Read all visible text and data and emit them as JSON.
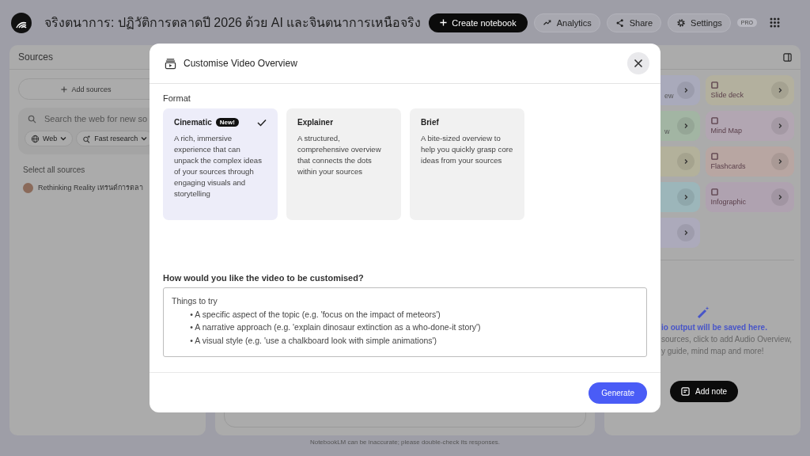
{
  "header": {
    "title": "จริงตนาการ: ปฏิวัติการตลาดปี 2026 ด้วย AI และจินตนาการเหนือจริง",
    "create_button": "Create notebook",
    "actions": [
      {
        "label": "Analytics",
        "kind": "analytics"
      },
      {
        "label": "Share",
        "kind": "share"
      },
      {
        "label": "Settings",
        "kind": "settings"
      }
    ],
    "badge": "PRO"
  },
  "sources": {
    "title": "Sources",
    "add_button": "Add sources",
    "search": {
      "placeholder": "Search the web for new so"
    },
    "chips": [
      {
        "label": "Web",
        "kind": "web"
      },
      {
        "label": "Fast research",
        "kind": "research"
      }
    ],
    "select_all": "Select all sources",
    "items": [
      {
        "label": "Rethinking Reality เทรนด์การตลา"
      }
    ]
  },
  "studio": {
    "tiles": [
      {
        "label": "ew",
        "color": "#a9aabb"
      },
      {
        "label": "Slide deck",
        "color": "#b3b09e"
      },
      {
        "label": "w",
        "color": "#a2b5a3"
      },
      {
        "label": "Mind Map",
        "color": "#b2a6b2"
      },
      {
        "color": "#b3b19b"
      },
      {
        "label": "Flashcards",
        "color": "#b8a6a2"
      },
      {
        "color": "#9cb6ba"
      },
      {
        "label": "Infographic",
        "color": "#afa2b0"
      },
      {
        "color": "#acaabb"
      }
    ],
    "empty_title": "io output will be saved here.",
    "empty_lines": [
      "sources, click to add Audio Overview,",
      "y guide, mind map and more!"
    ],
    "add_note": "Add note"
  },
  "footer": "NotebookLM can be inaccurate; please double-check its responses.",
  "dialog": {
    "title": "Customise Video Overview",
    "format_label": "Format",
    "formats": [
      {
        "name": "Cinematic",
        "badge": "New!",
        "selected": true,
        "description": "A rich, immersive experience that can unpack the complex ideas of your sources through engaging visuals and storytelling"
      },
      {
        "name": "Explainer",
        "selected": false,
        "description": "A structured, comprehensive overview that connects the dots within your sources"
      },
      {
        "name": "Brief",
        "selected": false,
        "description": "A bite-sized overview to help you quickly grasp core ideas from your sources"
      }
    ],
    "question": "How would you like the video to be customised?",
    "prompt": {
      "placeholder": "Things to try\n        • A specific aspect of the topic (e.g. 'focus on the impact of meteors')\n        • A narrative approach (e.g. 'explain dinosaur extinction as a who-done-it story')\n        • A visual style (e.g. 'use a chalkboard look with simple animations')"
    },
    "generate_button": "Generate"
  }
}
